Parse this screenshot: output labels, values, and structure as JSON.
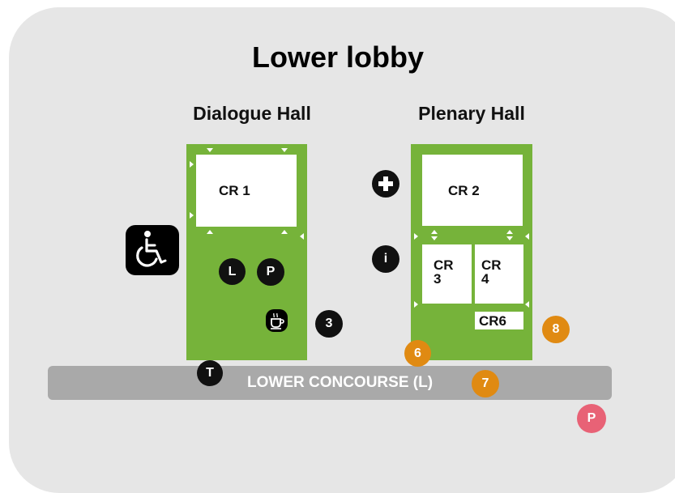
{
  "map": {
    "title": "Lower lobby",
    "halls": {
      "dialogue": "Dialogue Hall",
      "plenary": "Plenary Hall"
    },
    "rooms": {
      "cr1": "CR 1",
      "cr2": "CR 2",
      "cr3": "CR 3",
      "cr4": "CR 4",
      "cr6": "CR6"
    },
    "concourse": "LOWER CONCOURSE (L)",
    "markers": {
      "l": "L",
      "p_black": "P",
      "t": "T",
      "i": "i",
      "three": "3",
      "six": "6",
      "seven": "7",
      "eight": "8",
      "p_pink": "P"
    },
    "icons": [
      "wheelchair-icon",
      "first-aid-icon",
      "coffee-icon",
      "info-icon"
    ],
    "colors": {
      "hall": "#76b33a",
      "concourse": "#a9a9a9",
      "badge_orange": "#e08a12",
      "badge_pink": "#e86276",
      "background": "#e6e6e6"
    }
  }
}
